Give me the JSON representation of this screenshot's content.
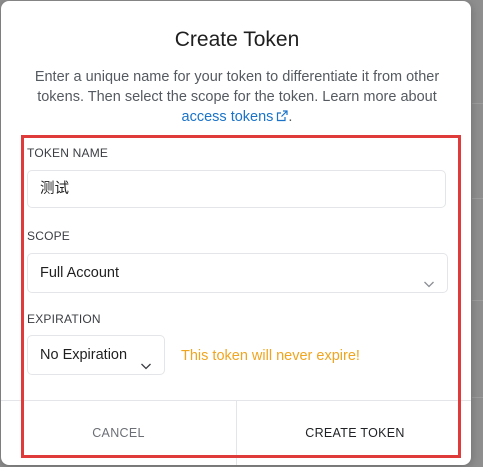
{
  "modal": {
    "title": "Create Token",
    "description_prefix": "Enter a unique name for your token to differentiate it from other tokens. Then select the scope for the token. Learn more about",
    "description_link": "access tokens",
    "description_suffix": "."
  },
  "form": {
    "token_name": {
      "label": "TOKEN NAME",
      "value": "测试"
    },
    "scope": {
      "label": "SCOPE",
      "selected": "Full Account"
    },
    "expiration": {
      "label": "EXPIRATION",
      "selected": "No Expiration",
      "note": "This token will never expire!"
    }
  },
  "footer": {
    "cancel_label": "CANCEL",
    "create_label": "CREATE TOKEN"
  },
  "colors": {
    "link": "#1a73c9",
    "warning": "#f0a520",
    "highlight_border": "#e03b3b"
  },
  "icons": {
    "external_link": "external-link-icon",
    "dropdown": "chevron-down-icon"
  }
}
